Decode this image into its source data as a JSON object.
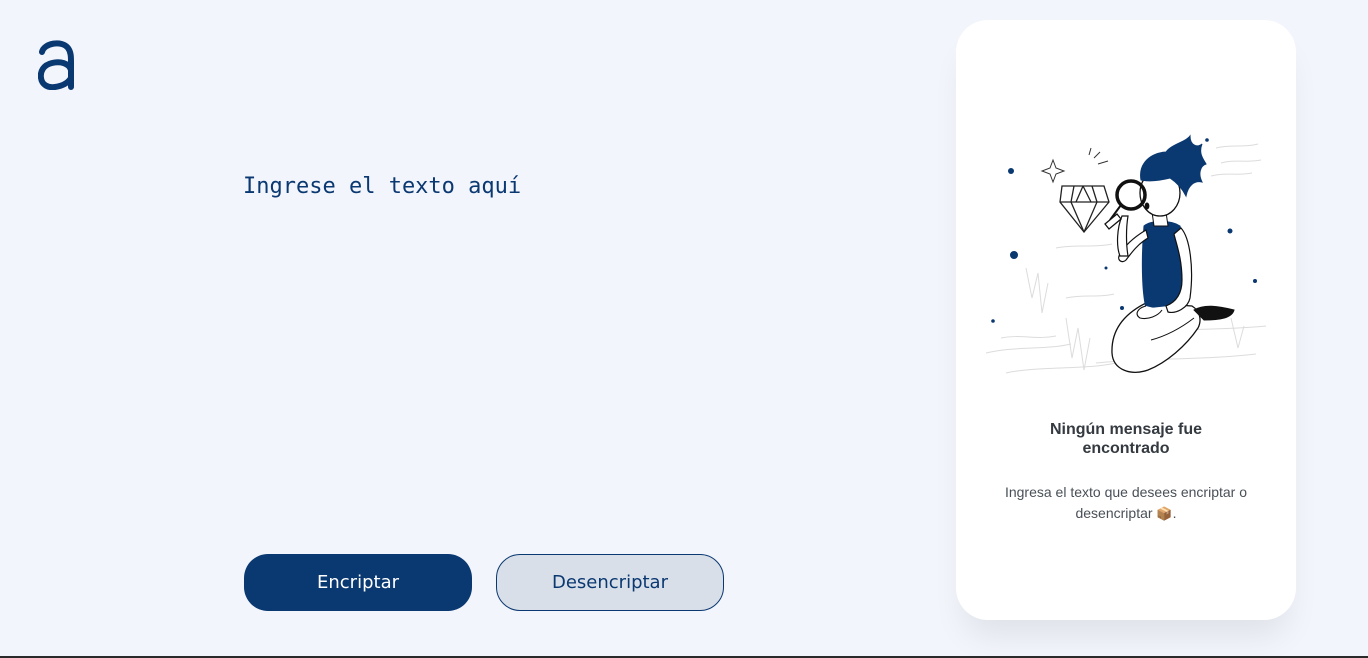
{
  "logo": {
    "icon": "alura-a-logo-icon",
    "color": "#0a3871"
  },
  "input": {
    "placeholder": "Ingrese el texto aquí",
    "value": ""
  },
  "buttons": {
    "encrypt_label": "Encriptar",
    "decrypt_label": "Desencriptar"
  },
  "panel": {
    "illustration": "person-with-magnifying-glass-and-diamond-illustration",
    "title": "Ningún mensaje fue encontrado",
    "text": "Ingresa el texto que desees encriptar o desencriptar",
    "text_icon": "📦",
    "text_suffix": "."
  },
  "colors": {
    "accent": "#0a3871",
    "background": "#f3f5fc",
    "panel": "#ffffff",
    "secondary_button": "#d8dfe8"
  }
}
